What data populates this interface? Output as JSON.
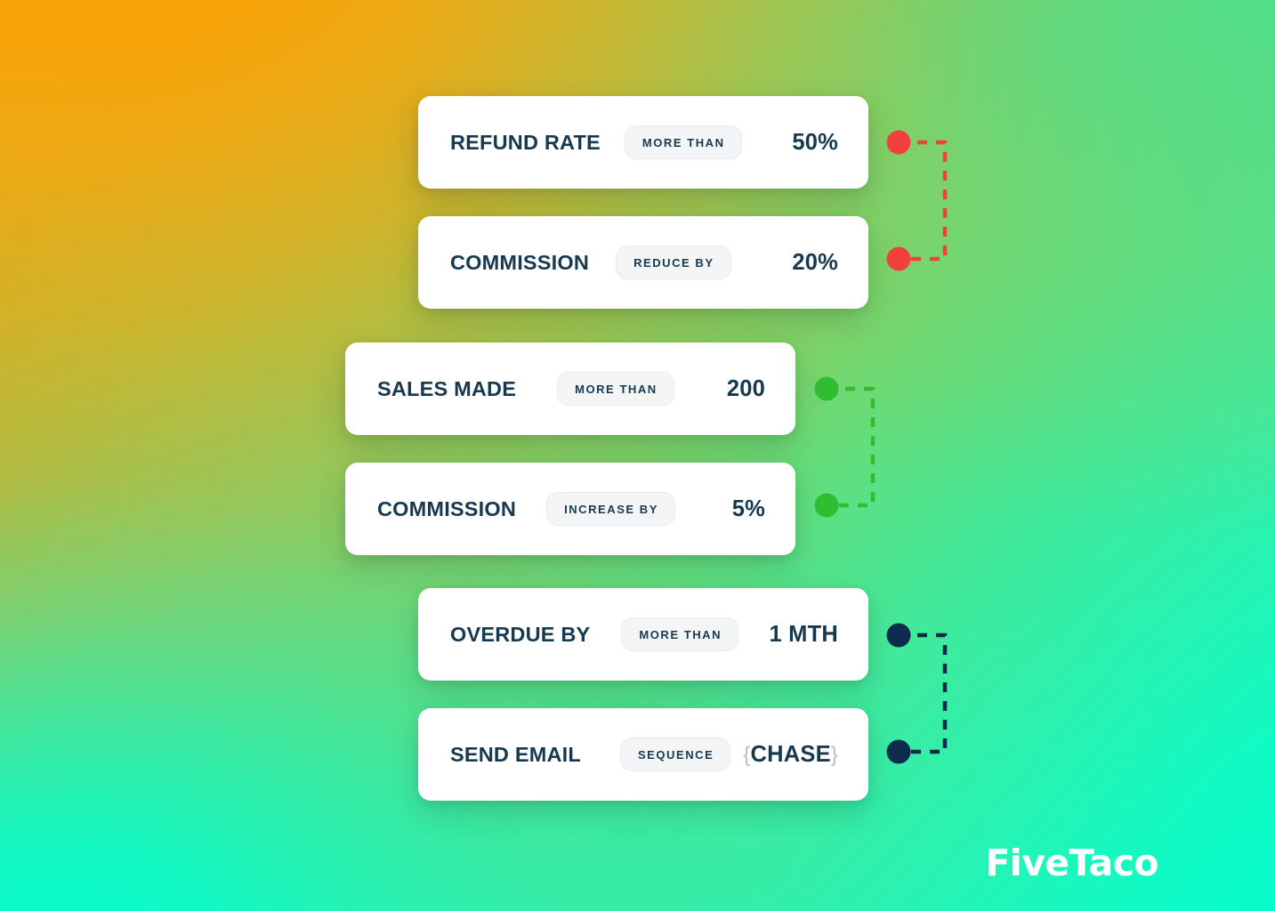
{
  "background": {
    "gradient_from": "#F9A004",
    "gradient_mid": "#8ECB5C",
    "gradient_to": "#06FCCB",
    "direction": "top-left orange to bottom-left spring-green"
  },
  "brand": {
    "logo_text": "FiveTaco",
    "logo_color": "#FFFFFF"
  },
  "theme": {
    "card_background": "#FFFFFF",
    "text_navy": "#17394F",
    "pill_background": "#F4F5F6",
    "pill_border": "#EAEBEC",
    "brace_color": "#B6C0C7"
  },
  "rules": [
    {
      "id": "refund-rate",
      "label": "REFUND RATE",
      "operator": "MORE THAN",
      "value": "50%",
      "group": "red"
    },
    {
      "id": "commission-reduce",
      "label": "COMMISSION",
      "operator": "REDUCE BY",
      "value": "20%",
      "group": "red"
    },
    {
      "id": "sales-made",
      "label": "SALES MADE",
      "operator": "MORE THAN",
      "value": "200",
      "group": "green"
    },
    {
      "id": "commission-increase",
      "label": "COMMISSION",
      "operator": "INCREASE BY",
      "value": "5%",
      "group": "green"
    },
    {
      "id": "overdue-by",
      "label": "OVERDUE BY",
      "operator": "MORE THAN",
      "value": "1 MTH",
      "group": "navy"
    },
    {
      "id": "send-email",
      "label": "SEND EMAIL",
      "operator": "SEQUENCE",
      "value_open_brace": "{",
      "value": "CHASE",
      "value_close_brace": "}",
      "group": "navy"
    }
  ],
  "connectors": [
    {
      "id": "connector-red",
      "color": "#F2403F",
      "links": [
        "refund-rate",
        "commission-reduce"
      ],
      "style": "dashed"
    },
    {
      "id": "connector-green",
      "color": "#2FBE31",
      "links": [
        "sales-made",
        "commission-increase"
      ],
      "style": "dashed"
    },
    {
      "id": "connector-navy",
      "color": "#0D2B4A",
      "links": [
        "overdue-by",
        "send-email"
      ],
      "style": "dashed"
    }
  ]
}
